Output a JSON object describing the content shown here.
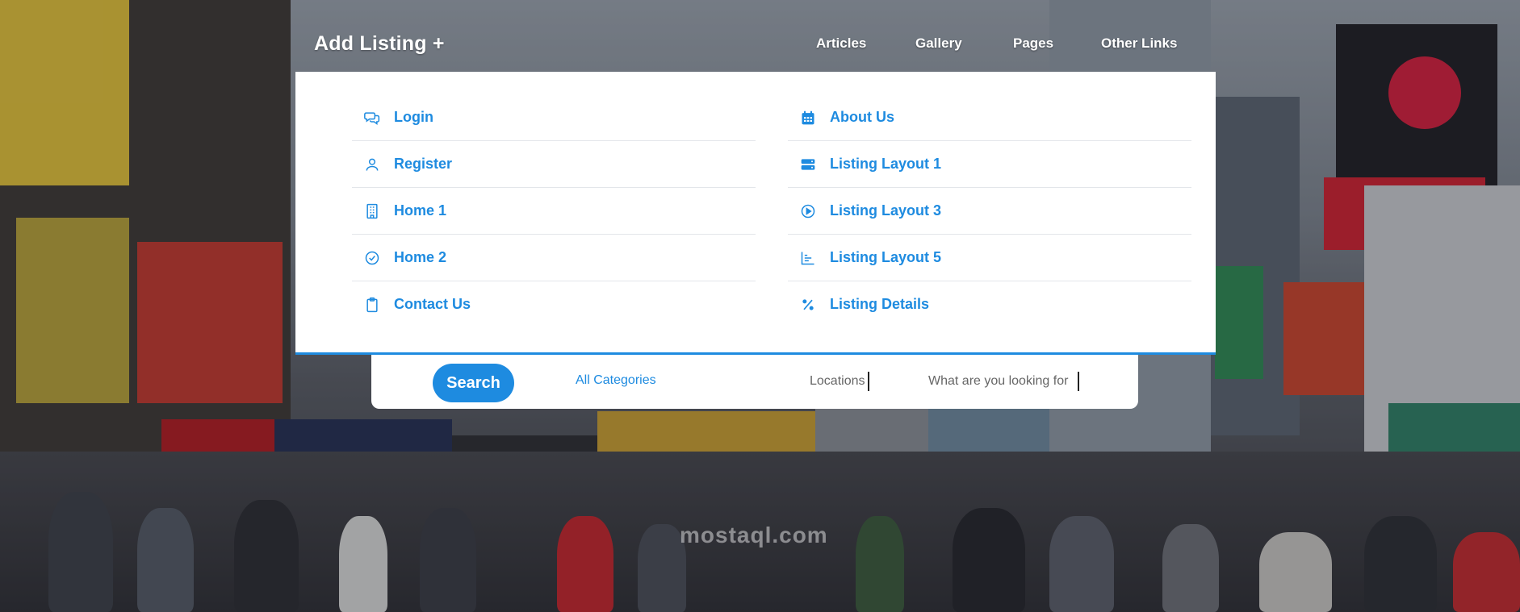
{
  "navbar": {
    "logo": "Add Listing +",
    "links": [
      "Articles",
      "Gallery",
      "Pages",
      "Other Links"
    ]
  },
  "menu": {
    "left": [
      {
        "label": "Login",
        "icon": "chat-icon"
      },
      {
        "label": "Register",
        "icon": "user-icon"
      },
      {
        "label": "Home 1",
        "icon": "building-icon"
      },
      {
        "label": "Home 2",
        "icon": "check-circle-icon"
      },
      {
        "label": "Contact Us",
        "icon": "clipboard-icon"
      }
    ],
    "right": [
      {
        "label": "About Us",
        "icon": "calendar-icon"
      },
      {
        "label": "Listing Layout 1",
        "icon": "server-icon"
      },
      {
        "label": "Listing Layout 3",
        "icon": "play-circle-icon"
      },
      {
        "label": "Listing Layout 5",
        "icon": "bar-chart-icon"
      },
      {
        "label": "Listing Details",
        "icon": "percent-icon"
      }
    ]
  },
  "search": {
    "button": "Search",
    "category": "All Categories",
    "location_placeholder": "Locations",
    "query_placeholder": "What are you looking for"
  },
  "watermark": {
    "text": "mostaql.com"
  },
  "colors": {
    "accent": "#1e8be0",
    "panel": "#ffffff",
    "divider": "#e3e6ea"
  }
}
